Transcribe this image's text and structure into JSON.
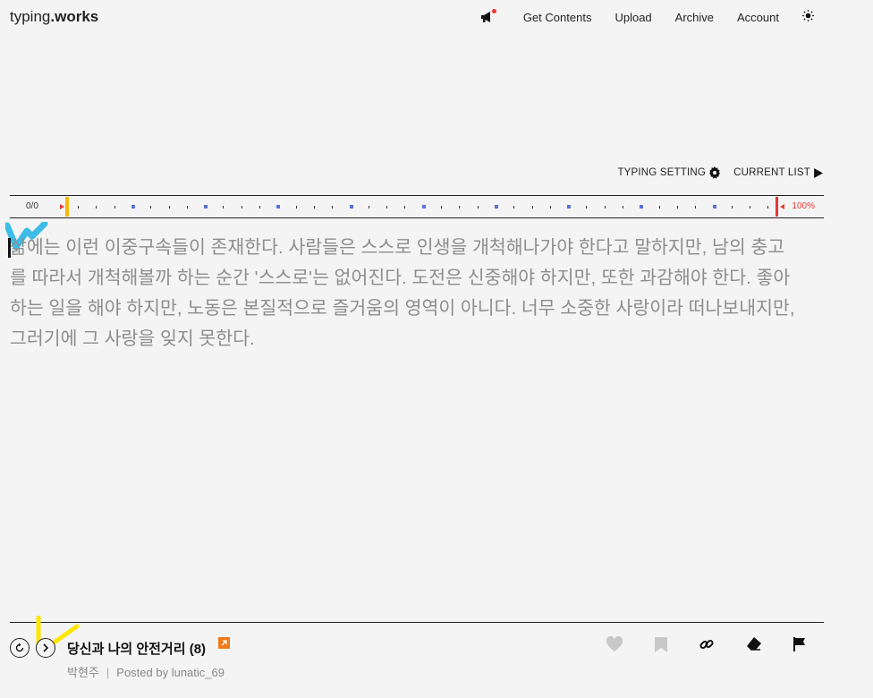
{
  "header": {
    "logo_prefix": "typing",
    "logo_suffix": ".works",
    "nav": [
      "Get Contents",
      "Upload",
      "Archive",
      "Account"
    ]
  },
  "settings": {
    "typing_setting": "TYPING SETTING",
    "current_list": "CURRENT LIST"
  },
  "progress": {
    "count": "0/0",
    "percent_label": "100%",
    "value": 0
  },
  "passage": {
    "text": "삶에는 이런 이중구속들이 존재한다. 사람들은 스스로 인생을 개척해나가야 한다고 말하지만, 남의 충고를 따라서 개척해볼까 하는 순간 '스스로'는 없어진다. 도전은 신중해야 하지만, 또한 과감해야 한다. 좋아하는 일을 해야 하지만, 노동은 본질적으로 즐거움의 영역이 아니다. 너무 소중한 사랑이라 떠나보내지만, 그러기에 그 사랑을 잊지 못한다."
  },
  "footer": {
    "title": "당신과 나의 안전거리 (8)",
    "author": "박현주",
    "separator": "|",
    "posted_by": "Posted by lunatic_69"
  },
  "colors": {
    "accent_yellow": "#f6b90b",
    "accent_red": "#e53935",
    "marker_blue": "#5872d8",
    "text_gray": "#8d8d8d",
    "highlight_cyan": "#29b6e6"
  },
  "icons": [
    "megaphone-icon",
    "sun-icon",
    "gear-icon",
    "play-icon",
    "restart-icon",
    "next-icon",
    "external-link-icon",
    "heart-icon",
    "bookmark-icon",
    "link-icon",
    "eraser-icon",
    "flag-icon"
  ]
}
